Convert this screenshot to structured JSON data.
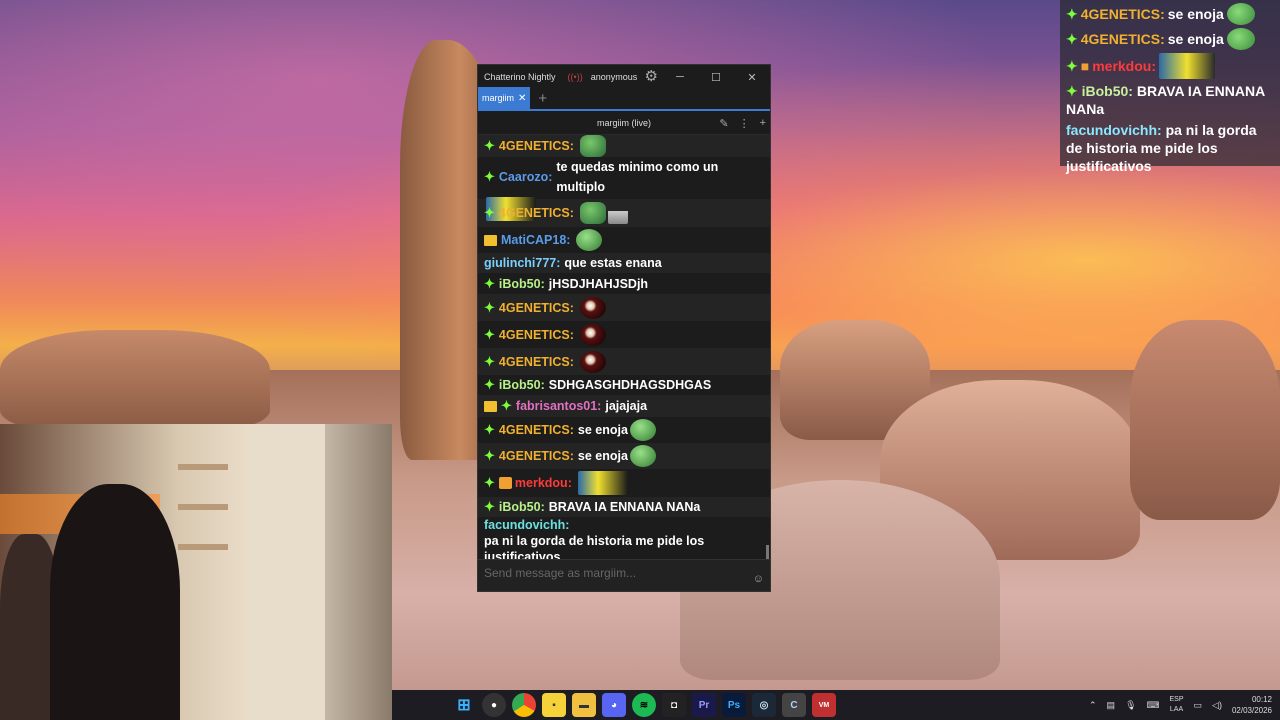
{
  "overlay": {
    "lines": [
      {
        "name": "4GENETICS:",
        "text": "se enoja"
      },
      {
        "name": "4GENETICS:",
        "text": "se enoja"
      },
      {
        "name": "merkdou:",
        "text": ""
      },
      {
        "name": "iBob50:",
        "text": "BRAVA IA ENNANA NANa"
      },
      {
        "name": "facundovichh:",
        "text": "pa ni la gorda de historia me pide los justificativos"
      }
    ]
  },
  "window": {
    "app_title": "Chatterino Nightly",
    "user": "anonymous",
    "tab_label": "margiim",
    "split_title": "margiim (live)",
    "input_placeholder": "Send message as margiim..."
  },
  "messages": [
    {
      "name": "4GENETICS:",
      "text": "",
      "emotes": [
        "pepe2"
      ]
    },
    {
      "name": "Caarozo:",
      "text": "te quedas minimo como un multiplo",
      "emotes": [
        "wide"
      ]
    },
    {
      "name": "4GENETICS:",
      "text": "",
      "emotes": [
        "pepe2",
        "smallfig"
      ]
    },
    {
      "name": "MatiCAP18:",
      "text": "",
      "emotes": [
        "pepe"
      ]
    },
    {
      "name": "giulinchi777:",
      "text": "que estas enana",
      "emotes": []
    },
    {
      "name": "iBob50:",
      "text": "jHSDJHAHJSDjh",
      "emotes": []
    },
    {
      "name": "4GENETICS:",
      "text": "",
      "emotes": [
        "ball"
      ]
    },
    {
      "name": "4GENETICS:",
      "text": "",
      "emotes": [
        "ball"
      ]
    },
    {
      "name": "4GENETICS:",
      "text": "",
      "emotes": [
        "ball"
      ]
    },
    {
      "name": "iBob50:",
      "text": "SDHGASGHDHAGSDHGAS",
      "emotes": []
    },
    {
      "name": "fabrisantos01:",
      "text": "jajajaja",
      "emotes": []
    },
    {
      "name": "4GENETICS:",
      "text": "se enoja",
      "emotes": [
        "pepe"
      ]
    },
    {
      "name": "4GENETICS:",
      "text": "se enoja",
      "emotes": [
        "pepe"
      ]
    },
    {
      "name": "merkdou:",
      "text": "",
      "emotes": [
        "wide"
      ]
    },
    {
      "name": "iBob50:",
      "text": "BRAVA IA ENNANA NANa",
      "emotes": []
    },
    {
      "name": "facundovichh:",
      "text": "pa ni la gorda de historia me pide los justificativos",
      "emotes": []
    }
  ],
  "taskbar": {
    "icons": [
      "windows-start-icon",
      "obs-icon",
      "chrome-icon",
      "sticky-notes-icon",
      "file-explorer-icon",
      "discord-icon",
      "spotify-icon",
      "capture-icon",
      "premiere-icon",
      "photoshop-icon",
      "steam-icon",
      "chatterino-icon",
      "voicemeeter-icon"
    ],
    "icon_labels": {
      "premiere": "Pr",
      "photoshop": "Ps"
    },
    "lang_top": "ESP",
    "lang_bottom": "LAA",
    "time": "00:12",
    "date": "02/03/2026"
  }
}
